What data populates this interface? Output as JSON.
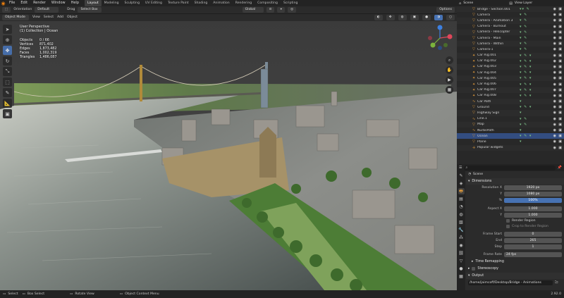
{
  "topbar": {
    "menus": [
      "File",
      "Edit",
      "Render",
      "Window",
      "Help"
    ],
    "workspaces": [
      "Layout",
      "Modeling",
      "Sculpting",
      "UV Editing",
      "Texture Paint",
      "Shading",
      "Animation",
      "Rendering",
      "Compositing",
      "Scripting"
    ],
    "active_workspace": "Layout",
    "scene_label": "Scene",
    "view_layer_label": "View Layer"
  },
  "viewport_header": {
    "orientation_label": "Orientation",
    "orientation_value": "Default",
    "drag_label": "Drag",
    "drag_value": "Select Box",
    "transform_space": "Global",
    "options_label": "Options",
    "mode": "Object Mode",
    "menus": [
      "View",
      "Select",
      "Add",
      "Object"
    ]
  },
  "viewport_info": {
    "view_name": "User Perspective",
    "collection": "(1) Collection | Ocean",
    "stats": [
      {
        "label": "Objects",
        "value": "0 / 66"
      },
      {
        "label": "Vertices",
        "value": "871,402"
      },
      {
        "label": "Edges",
        "value": "1,873,482"
      },
      {
        "label": "Faces",
        "value": "1,002,319"
      },
      {
        "label": "Triangles",
        "value": "1,486,087"
      }
    ]
  },
  "outliner": {
    "search_placeholder": "",
    "rows": [
      {
        "name": "Bridge - Section.001",
        "icon": "object-icon",
        "mods": "▾▾ ✎"
      },
      {
        "name": "Camera",
        "icon": "camera-icon",
        "mods": "▾ ✎"
      },
      {
        "name": "Camera - Animation 3",
        "icon": "camera-icon",
        "mods": "▾ ✎"
      },
      {
        "name": "Camera - Burnout",
        "icon": "camera-icon",
        "mods": "▾ ✎"
      },
      {
        "name": "Camera - Helicopter",
        "icon": "camera-icon",
        "mods": "▾ ✎"
      },
      {
        "name": "Camera - Main",
        "icon": "camera-icon",
        "mods": "▾ ✎"
      },
      {
        "name": "Camera - Within",
        "icon": "camera-icon",
        "mods": "▾ ✎"
      },
      {
        "name": "Camera-1",
        "icon": "camera-icon",
        "mods": "▾ ✎"
      },
      {
        "name": "Car Rig.001",
        "icon": "armature-icon",
        "mods": "▾ ✎ ▾"
      },
      {
        "name": "Car Rig.002",
        "icon": "armature-icon",
        "mods": "▾ ✎ ▾"
      },
      {
        "name": "Car Rig.003",
        "icon": "armature-icon",
        "mods": "▾ ✎ ▾"
      },
      {
        "name": "Car Rig.004",
        "icon": "armature-icon",
        "mods": "▾ ✎ ▾"
      },
      {
        "name": "Car Rig.005",
        "icon": "armature-icon",
        "mods": "▾ ✎ ▾"
      },
      {
        "name": "Car Rig.006",
        "icon": "armature-icon",
        "mods": "▾ ✎ ▾"
      },
      {
        "name": "Car Rig.007",
        "icon": "armature-icon",
        "mods": "▾ ✎ ▾"
      },
      {
        "name": "Car Rig.008",
        "icon": "armature-icon",
        "mods": "▾ ✎ ▾"
      },
      {
        "name": "Car Path",
        "icon": "curve-icon",
        "mods": "▾"
      },
      {
        "name": "Ground",
        "icon": "mesh-icon",
        "mods": "▾ ✎ ▾"
      },
      {
        "name": "Highway Sign",
        "icon": "mesh-icon",
        "mods": "▾"
      },
      {
        "name": "Line.1",
        "icon": "curve-icon",
        "mods": "▾ ✎"
      },
      {
        "name": "Map",
        "icon": "mesh-icon",
        "mods": "▾ ✎"
      },
      {
        "name": "NurbsPath",
        "icon": "curve-icon",
        "mods": "▾"
      },
      {
        "name": "Ocean",
        "icon": "mesh-icon",
        "mods": "▾ ✎ ▾",
        "selected": true
      },
      {
        "name": "Plane",
        "icon": "mesh-icon",
        "mods": "▾"
      },
      {
        "name": "Popular widgets",
        "icon": "empty-icon",
        "mods": ""
      }
    ]
  },
  "properties": {
    "scene_name": "Scene",
    "dimensions_label": "Dimensions",
    "fields": [
      {
        "label": "Resolution X",
        "value": "1920 px"
      },
      {
        "label": "Y",
        "value": "1080 px"
      },
      {
        "label": "%",
        "value": "100%",
        "highlight": true
      },
      {
        "label": "Aspect X",
        "value": "1.000"
      },
      {
        "label": "Y",
        "value": "1.000"
      }
    ],
    "render_region_label": "Render Region",
    "crop_label": "Crop to Render Region",
    "frame_fields": [
      {
        "label": "Frame Start",
        "value": "0"
      },
      {
        "label": "End",
        "value": "265"
      },
      {
        "label": "Step",
        "value": "1"
      }
    ],
    "frame_rate_label": "Frame Rate",
    "frame_rate_value": "24 fps",
    "subpanels": [
      "Time Remapping",
      "Stereoscopy"
    ],
    "output_label": "Output",
    "output_path": "/home/jaimcoff/Desktop/Bridge - Animations"
  },
  "statusbar": {
    "items": [
      "Select",
      "Box Select",
      "Rotate View",
      "Object Context Menu"
    ],
    "version": "2.92.0"
  },
  "colors": {
    "accent": "#4772b3",
    "brand": "#e87d0d"
  }
}
